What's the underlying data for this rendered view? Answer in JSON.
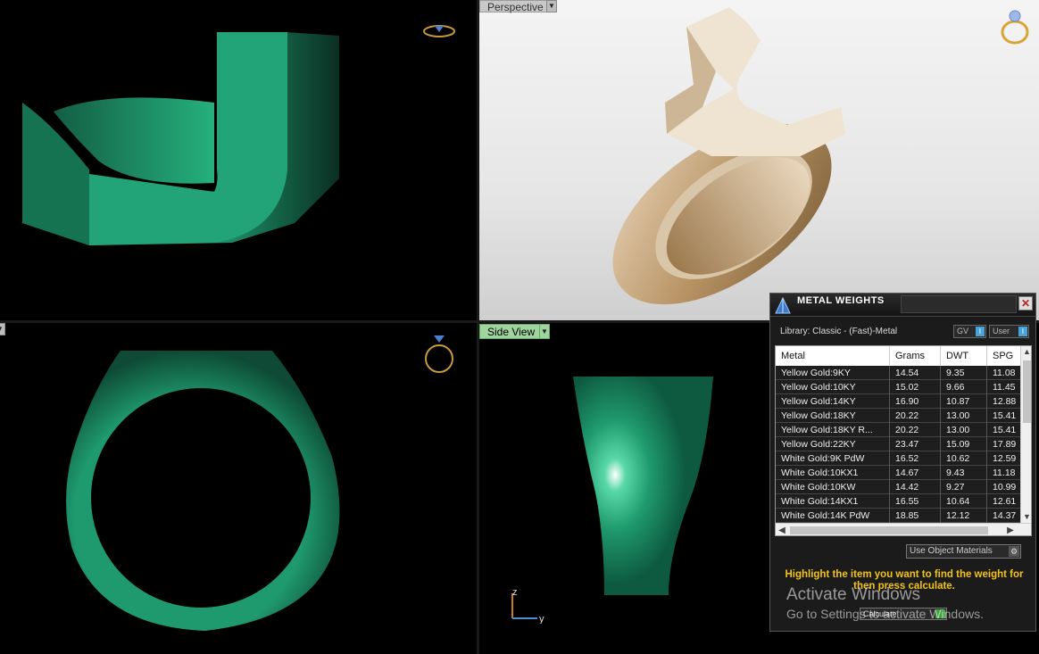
{
  "viewports": {
    "perspective_label": "Perspective",
    "side_label": "Side View"
  },
  "panel": {
    "title": "METAL WEIGHTS",
    "close_glyph": "✕",
    "library_label": "Library: Classic - (Fast)-Metal",
    "toggle_gv": "GV",
    "toggle_user": "User",
    "toggle_knob": "I",
    "columns": {
      "metal": "Metal",
      "grams": "Grams",
      "dwt": "DWT",
      "spg": "SPG"
    },
    "rows": [
      {
        "metal": "Yellow Gold:9KY",
        "grams": "14.54",
        "dwt": "9.35",
        "spg": "11.08"
      },
      {
        "metal": "Yellow Gold:10KY",
        "grams": "15.02",
        "dwt": "9.66",
        "spg": "11.45"
      },
      {
        "metal": "Yellow Gold:14KY",
        "grams": "16.90",
        "dwt": "10.87",
        "spg": "12.88"
      },
      {
        "metal": "Yellow Gold:18KY",
        "grams": "20.22",
        "dwt": "13.00",
        "spg": "15.41"
      },
      {
        "metal": "Yellow Gold:18KY R...",
        "grams": "20.22",
        "dwt": "13.00",
        "spg": "15.41"
      },
      {
        "metal": "Yellow Gold:22KY",
        "grams": "23.47",
        "dwt": "15.09",
        "spg": "17.89"
      },
      {
        "metal": "White Gold:9K PdW",
        "grams": "16.52",
        "dwt": "10.62",
        "spg": "12.59"
      },
      {
        "metal": "White Gold:10KX1",
        "grams": "14.67",
        "dwt": "9.43",
        "spg": "11.18"
      },
      {
        "metal": "White Gold:10KW",
        "grams": "14.42",
        "dwt": "9.27",
        "spg": "10.99"
      },
      {
        "metal": "White Gold:14KX1",
        "grams": "16.55",
        "dwt": "10.64",
        "spg": "12.61"
      },
      {
        "metal": "White Gold:14K PdW",
        "grams": "18.85",
        "dwt": "12.12",
        "spg": "14.37"
      }
    ],
    "use_object_materials": "Use Object Materials",
    "hint": "Highlight the item you want to find the weight for then press calculate.",
    "calculate_label": "Calculate"
  },
  "watermark": {
    "line1": "Activate Windows",
    "line2": "Go to Settings to activate Windows."
  },
  "axis": {
    "z": "z",
    "y": "y"
  },
  "colors": {
    "ring_green": "#1f9a6e",
    "ring_gold": "#c8a979",
    "hint_yellow": "#f2c318"
  }
}
